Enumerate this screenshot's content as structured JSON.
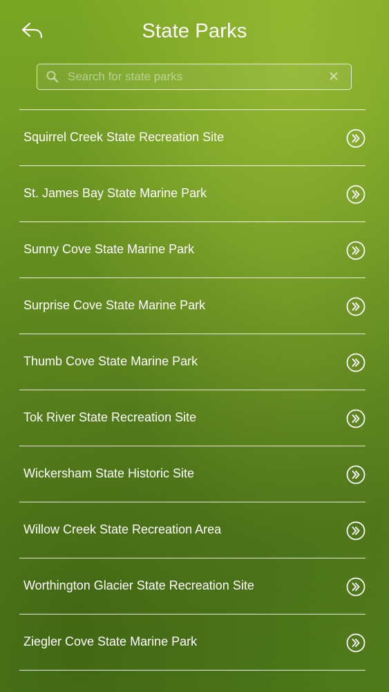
{
  "header": {
    "title": "State Parks",
    "back_icon": "back-arrow-icon"
  },
  "search": {
    "placeholder": "Search for state parks",
    "value": "",
    "icon": "search-icon",
    "clear_icon": "clear-icon"
  },
  "parks": {
    "items": [
      {
        "name": "Squirrel Creek State Recreation Site"
      },
      {
        "name": "St. James Bay State Marine Park"
      },
      {
        "name": "Sunny Cove State Marine Park"
      },
      {
        "name": "Surprise Cove State Marine Park"
      },
      {
        "name": "Thumb Cove State Marine Park"
      },
      {
        "name": "Tok River State Recreation Site"
      },
      {
        "name": "Wickersham State Historic Site"
      },
      {
        "name": "Willow Creek State Recreation Area"
      },
      {
        "name": "Worthington Glacier State Recreation Site"
      },
      {
        "name": "Ziegler Cove State Marine Park"
      }
    ],
    "item_icon": "double-chevron-right-circle-icon"
  },
  "colors": {
    "background": "#6a9622",
    "text": "#ffffff"
  }
}
